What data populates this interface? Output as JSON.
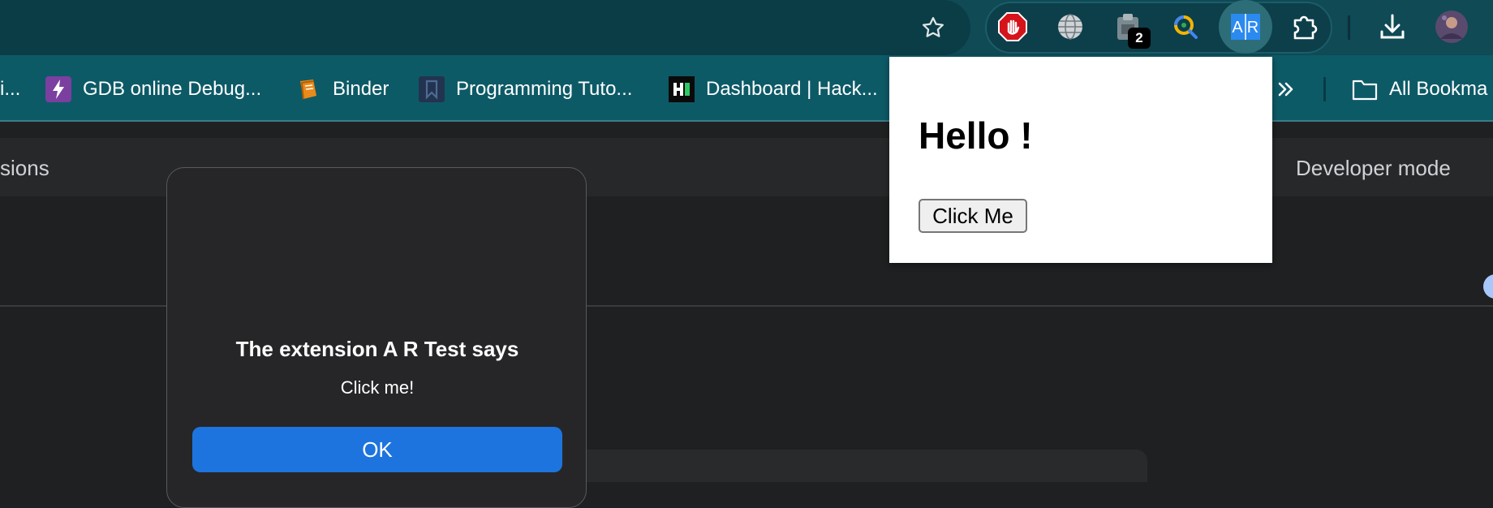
{
  "toolbar": {
    "extensions": [
      {
        "name": "adblock",
        "color": "#d4141a"
      },
      {
        "name": "globe",
        "color": "#d6d6d6"
      },
      {
        "name": "clipboard",
        "badge": "2"
      },
      {
        "name": "search-lens"
      },
      {
        "name": "ar-test",
        "active": true
      },
      {
        "name": "puzzle"
      }
    ],
    "badge_count": "2"
  },
  "bookmarks": {
    "partial_left": "i...",
    "items": [
      {
        "label": "GDB online Debug...",
        "icon": "bolt-icon",
        "color": "#7b3fa0"
      },
      {
        "label": "Binder",
        "icon": "book-icon",
        "color": "#e98a1a"
      },
      {
        "label": "Programming Tuto...",
        "icon": "bookmark-icon",
        "color": "#2b3a5a"
      },
      {
        "label": "Dashboard | Hack...",
        "icon": "hackerrank-icon",
        "color": "#0a0a0a"
      }
    ],
    "all_bookmarks": "All Bookma"
  },
  "page": {
    "header_left": "sions",
    "developer_mode_label": "Developer mode"
  },
  "dialog": {
    "title": "The extension A R Test says",
    "message": "Click me!",
    "ok_label": "OK"
  },
  "popup": {
    "heading": "Hello !",
    "button_label": "Click Me"
  },
  "colors": {
    "toolbar_bg": "#0f4a55",
    "bookmarks_bg": "#0d5a67",
    "dialog_button": "#1d74de"
  }
}
